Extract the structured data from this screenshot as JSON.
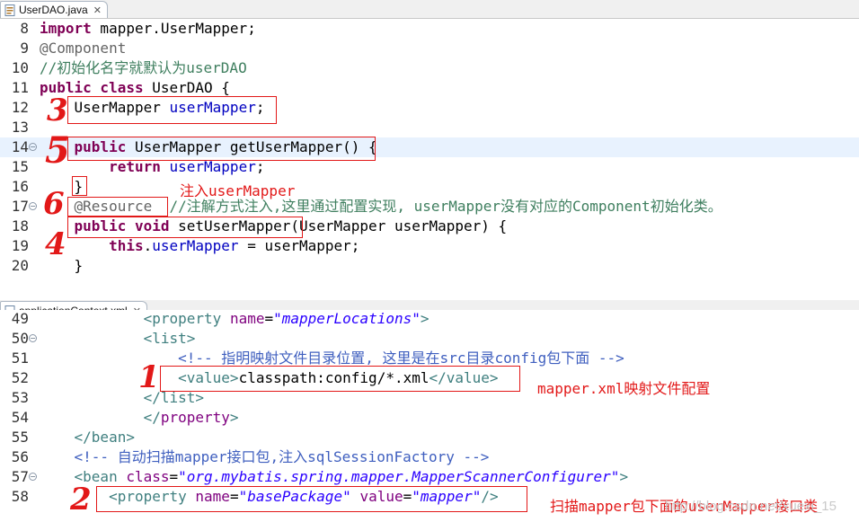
{
  "tabs": {
    "java_tab": "UserDAO.java",
    "xml_tab": "applicationContext.xml"
  },
  "java_lines": [
    {
      "n": "8",
      "parts": [
        [
          "kw",
          "import"
        ],
        [
          "t",
          " mapper.UserMapper;"
        ]
      ]
    },
    {
      "n": "9",
      "parts": [
        [
          "an",
          "@Component"
        ]
      ]
    },
    {
      "n": "10",
      "parts": [
        [
          "cm",
          "//初始化名字就默认为userDAO"
        ]
      ]
    },
    {
      "n": "11",
      "parts": [
        [
          "kw",
          "public class"
        ],
        [
          "t",
          " UserDAO {"
        ]
      ]
    },
    {
      "n": "12",
      "parts": [
        [
          "t",
          "    UserMapper "
        ],
        [
          "fd",
          "userMapper"
        ],
        [
          "t",
          ";"
        ]
      ]
    },
    {
      "n": "13",
      "parts": []
    },
    {
      "n": "14",
      "fold": true,
      "hl": true,
      "parts": [
        [
          "t",
          "    "
        ],
        [
          "kw",
          "public"
        ],
        [
          "t",
          " UserMapper getUserMapper() {"
        ]
      ]
    },
    {
      "n": "15",
      "parts": [
        [
          "t",
          "        "
        ],
        [
          "kw",
          "return"
        ],
        [
          "t",
          " "
        ],
        [
          "fd",
          "userMapper"
        ],
        [
          "t",
          ";"
        ]
      ]
    },
    {
      "n": "16",
      "parts": [
        [
          "t",
          "    }"
        ]
      ]
    },
    {
      "n": "17",
      "fold": true,
      "parts": [
        [
          "t",
          "    "
        ],
        [
          "an",
          "@Resource"
        ],
        [
          "t",
          "  "
        ],
        [
          "cm",
          "//注解方式注入,这里通过配置实现, userMapper没有对应的Component初始化类。"
        ]
      ]
    },
    {
      "n": "18",
      "parts": [
        [
          "t",
          "    "
        ],
        [
          "kw",
          "public void"
        ],
        [
          "t",
          " setUserMapper(UserMapper userMapper) {"
        ]
      ]
    },
    {
      "n": "19",
      "parts": [
        [
          "t",
          "        "
        ],
        [
          "kw",
          "this"
        ],
        [
          "t",
          "."
        ],
        [
          "fd",
          "userMapper"
        ],
        [
          "t",
          " = userMapper;"
        ]
      ]
    },
    {
      "n": "20",
      "parts": [
        [
          "t",
          "    }"
        ]
      ]
    }
  ],
  "xml_lines": [
    {
      "n": "49",
      "parts": [
        [
          "t",
          "            "
        ],
        [
          "tg",
          "<property"
        ],
        [
          "t",
          " "
        ],
        [
          "at",
          "name"
        ],
        [
          "t",
          "="
        ],
        [
          "av",
          "\"mapperLocations\""
        ],
        [
          "tg",
          ">"
        ]
      ]
    },
    {
      "n": "50",
      "fold": true,
      "parts": [
        [
          "t",
          "            "
        ],
        [
          "tg",
          "<list>"
        ]
      ]
    },
    {
      "n": "51",
      "parts": [
        [
          "t",
          "                "
        ],
        [
          "xc",
          "<!-- 指明映射文件目录位置, 这里是在src目录config包下面 -->"
        ]
      ]
    },
    {
      "n": "52",
      "parts": [
        [
          "t",
          "                "
        ],
        [
          "tg",
          "<value>"
        ],
        [
          "t",
          "classpath:config/*.xml"
        ],
        [
          "tg",
          "</value>"
        ]
      ]
    },
    {
      "n": "53",
      "parts": [
        [
          "t",
          "            "
        ],
        [
          "tg",
          "</list>"
        ]
      ]
    },
    {
      "n": "54",
      "parts": [
        [
          "t",
          "            "
        ],
        [
          "tg",
          "</"
        ],
        [
          "at",
          "property"
        ],
        [
          "tg",
          ">"
        ]
      ]
    },
    {
      "n": "55",
      "parts": [
        [
          "t",
          "    "
        ],
        [
          "tg",
          "</bean>"
        ]
      ]
    },
    {
      "n": "56",
      "parts": [
        [
          "t",
          "    "
        ],
        [
          "xc",
          "<!-- 自动扫描mapper接口包,注入sqlSessionFactory -->"
        ]
      ]
    },
    {
      "n": "57",
      "fold": true,
      "parts": [
        [
          "t",
          "    "
        ],
        [
          "tg",
          "<bean"
        ],
        [
          "t",
          " "
        ],
        [
          "at",
          "class"
        ],
        [
          "t",
          "="
        ],
        [
          "av",
          "\"org.mybatis.spring.mapper.MapperScannerConfigurer\""
        ],
        [
          "tg",
          ">"
        ]
      ]
    },
    {
      "n": "58",
      "parts": [
        [
          "t",
          "        "
        ],
        [
          "tg",
          "<property"
        ],
        [
          "t",
          " "
        ],
        [
          "at",
          "name"
        ],
        [
          "t",
          "="
        ],
        [
          "av",
          "\"basePackage\""
        ],
        [
          "t",
          " "
        ],
        [
          "at",
          "value"
        ],
        [
          "t",
          "="
        ],
        [
          "av",
          "\"mapper\""
        ],
        [
          "tg",
          "/>"
        ]
      ]
    }
  ],
  "annotations": {
    "note_inject": "注入userMapper",
    "note_mapper_xml": "mapper.xml映射文件配置",
    "note_scan": "扫描mapper包下面的userMapper接口类",
    "hand_1": "1",
    "hand_2": "2",
    "hand_3": "3",
    "hand_4": "4",
    "hand_5": "5",
    "hand_6": "6",
    "watermark": "http://blog.csdn.net/xuexi_15"
  },
  "colors": {
    "keyword": "#7f0055",
    "annotation_red": "#e21818",
    "comment": "#3f7f5f",
    "field": "#0000c0"
  }
}
